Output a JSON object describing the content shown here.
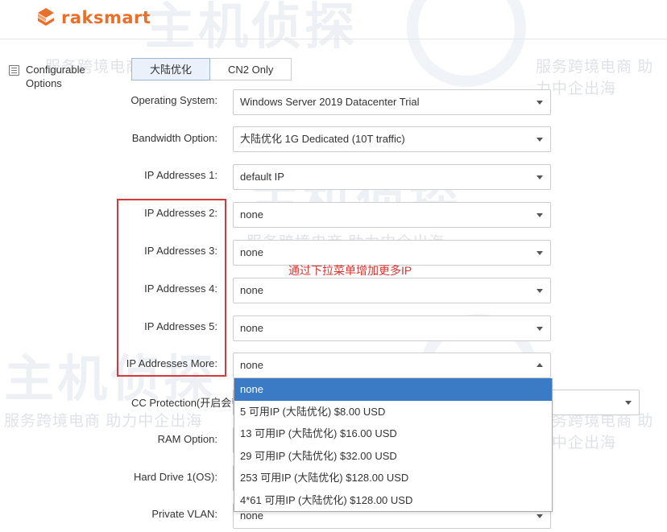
{
  "brand": {
    "name": "raksmart",
    "color": "#e8702a"
  },
  "watermark": {
    "text": "服务跨境电商 助力中企出海",
    "big": "主机侦探"
  },
  "section": {
    "title": "Configurable Options",
    "icon": "list-icon"
  },
  "tabs": [
    {
      "label": "大陆优化",
      "active": true
    },
    {
      "label": "CN2 Only",
      "active": false
    }
  ],
  "fields": [
    {
      "label": "Operating System:",
      "value": "Windows Server 2019 Datacenter Trial"
    },
    {
      "label": "Bandwidth Option:",
      "value": "大陆优化 1G Dedicated (10T traffic)"
    },
    {
      "label": "IP Addresses 1:",
      "value": "default IP"
    },
    {
      "label": "IP Addresses 2:",
      "value": "none"
    },
    {
      "label": "IP Addresses 3:",
      "value": "none"
    },
    {
      "label": "IP Addresses 4:",
      "value": "none"
    },
    {
      "label": "IP Addresses 5:",
      "value": "none"
    },
    {
      "label": "IP Addresses More:",
      "value": "none"
    },
    {
      "label": "CC Protection(开启会帮",
      "value": ""
    },
    {
      "label": "RAM Option:",
      "value": ""
    },
    {
      "label": "Hard Drive 1(OS):",
      "value": ""
    },
    {
      "label": "Private VLAN:",
      "value": "none"
    }
  ],
  "annotation": "通过下拉菜单增加更多IP",
  "dropdown": {
    "options": [
      "none",
      "5 可用IP (大陆优化) $8.00 USD",
      "13 可用IP (大陆优化) $16.00 USD",
      "29 可用IP (大陆优化) $32.00 USD",
      "253 可用IP (大陆优化) $128.00 USD",
      "4*61 可用IP (大陆优化) $128.00 USD"
    ],
    "selected_index": 0
  },
  "colors": {
    "highlight_box": "#d9383a",
    "annotation": "#e0312d",
    "selected_option": "#3b7bc6"
  }
}
